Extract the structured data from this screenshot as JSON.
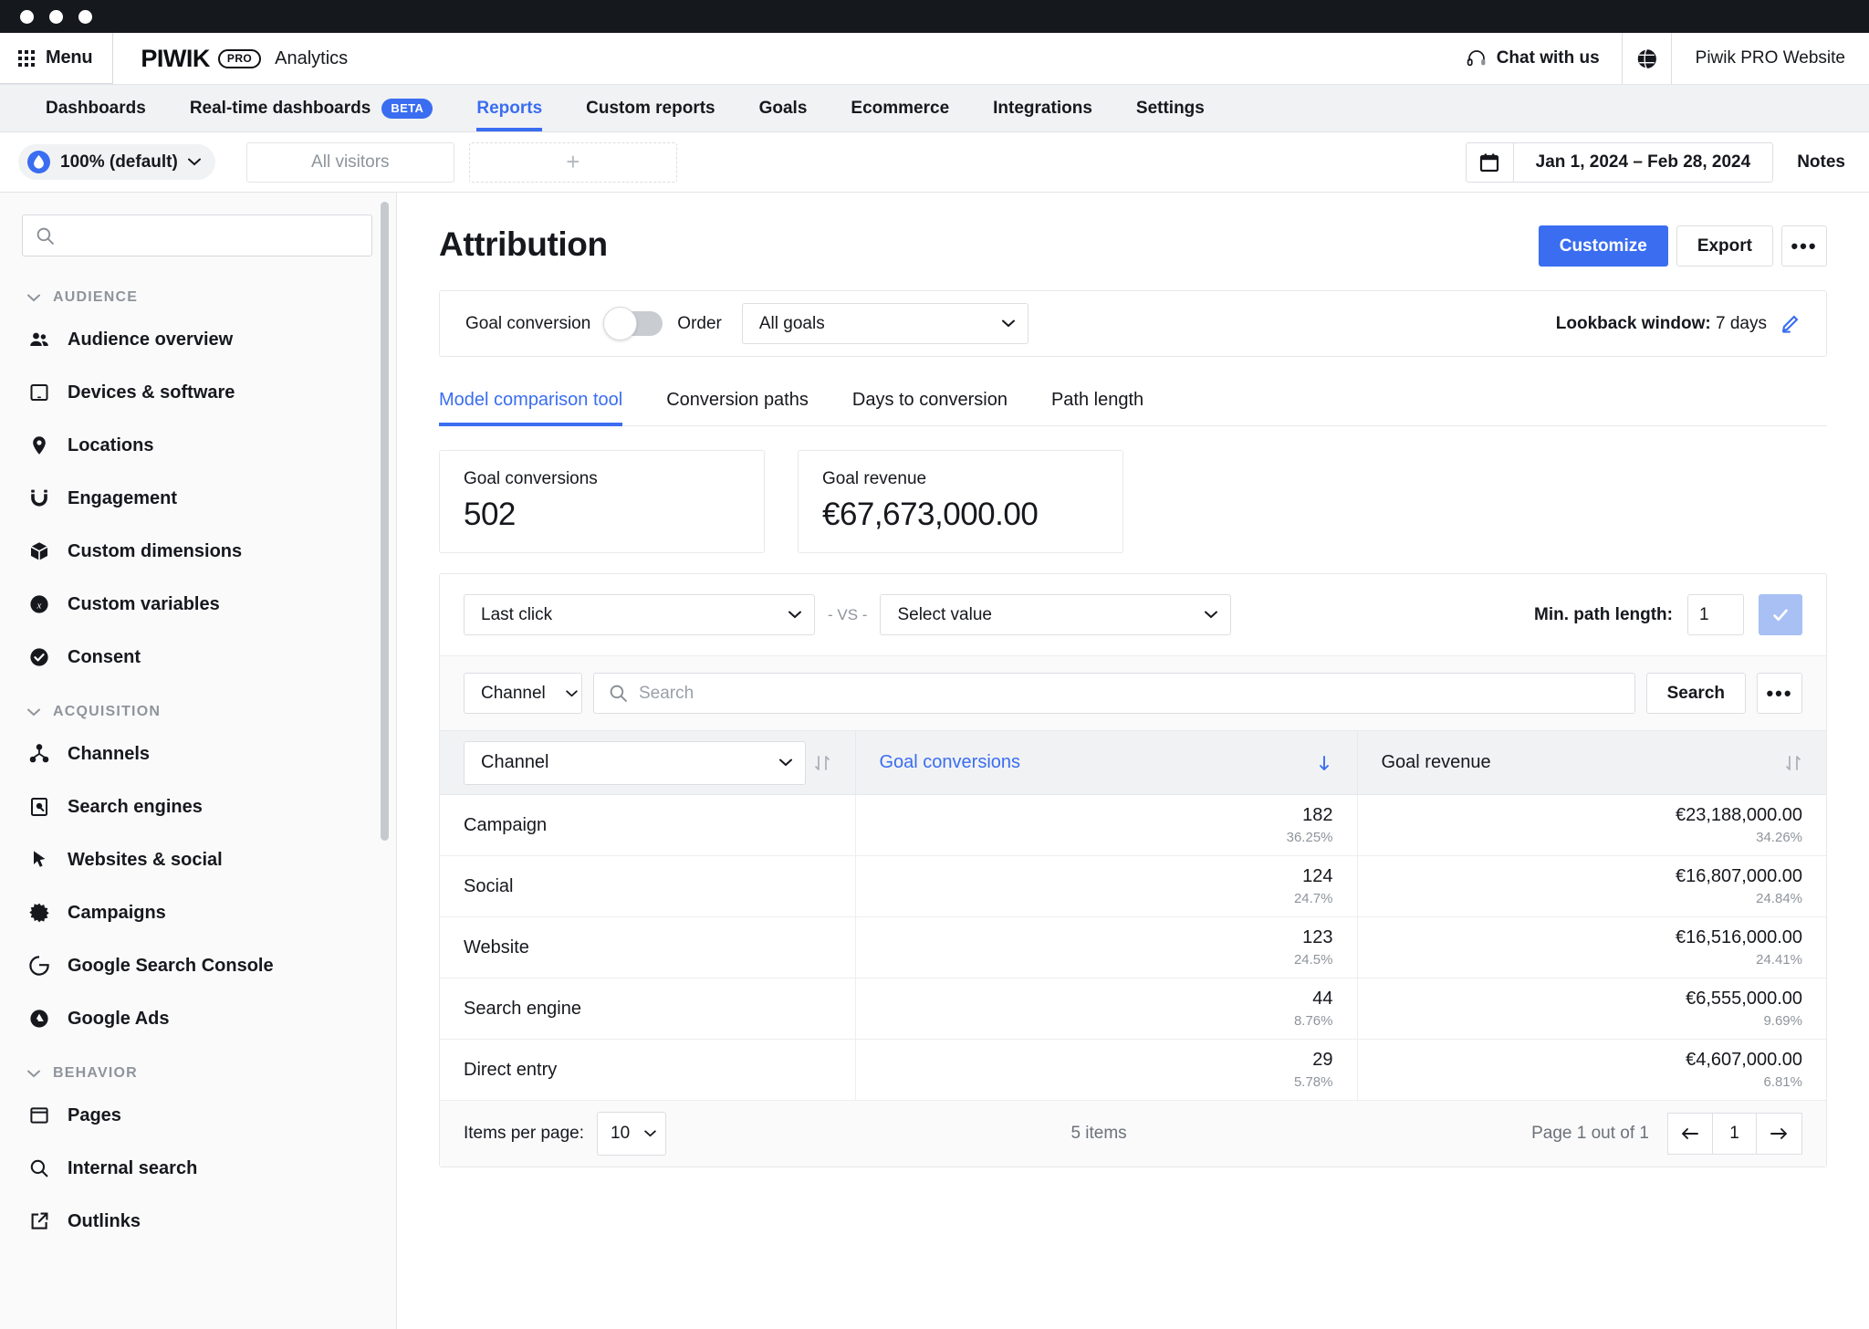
{
  "window": {
    "dots": 3
  },
  "appbar": {
    "menu_label": "Menu",
    "brand_piwik": "PIWIK",
    "brand_pro": "PRO",
    "brand_product": "Analytics",
    "chat_label": "Chat with us",
    "site_name": "Piwik PRO Website"
  },
  "nav": {
    "items": [
      {
        "label": "Dashboards",
        "active": false,
        "badge": ""
      },
      {
        "label": "Real-time dashboards",
        "active": false,
        "badge": "BETA"
      },
      {
        "label": "Reports",
        "active": true,
        "badge": ""
      },
      {
        "label": "Custom reports",
        "active": false,
        "badge": ""
      },
      {
        "label": "Goals",
        "active": false,
        "badge": ""
      },
      {
        "label": "Ecommerce",
        "active": false,
        "badge": ""
      },
      {
        "label": "Integrations",
        "active": false,
        "badge": ""
      },
      {
        "label": "Settings",
        "active": false,
        "badge": ""
      }
    ]
  },
  "subbar": {
    "sampling_label": "100% (default)",
    "segment_label": "All visitors",
    "segment_add_label": "+",
    "date_range": "Jan 1, 2024 – Feb 28, 2024",
    "notes_label": "Notes"
  },
  "sidebar": {
    "search_placeholder": "",
    "search_value": "",
    "sections": [
      {
        "title": "AUDIENCE",
        "items": [
          {
            "label": "Audience overview",
            "icon": "people-icon"
          },
          {
            "label": "Devices & software",
            "icon": "tablet-icon"
          },
          {
            "label": "Locations",
            "icon": "map-pin-icon"
          },
          {
            "label": "Engagement",
            "icon": "magnet-icon"
          },
          {
            "label": "Custom dimensions",
            "icon": "cube-icon"
          },
          {
            "label": "Custom variables",
            "icon": "variable-icon"
          },
          {
            "label": "Consent",
            "icon": "check-circle-icon"
          }
        ]
      },
      {
        "title": "ACQUISITION",
        "items": [
          {
            "label": "Channels",
            "icon": "share-nodes-icon"
          },
          {
            "label": "Search engines",
            "icon": "search-page-icon"
          },
          {
            "label": "Websites & social",
            "icon": "cursor-icon"
          },
          {
            "label": "Campaigns",
            "icon": "burst-icon"
          },
          {
            "label": "Google Search Console",
            "icon": "google-g-icon"
          },
          {
            "label": "Google Ads",
            "icon": "google-ads-icon"
          }
        ]
      },
      {
        "title": "BEHAVIOR",
        "items": [
          {
            "label": "Pages",
            "icon": "window-icon"
          },
          {
            "label": "Internal search",
            "icon": "search-icon"
          },
          {
            "label": "Outlinks",
            "icon": "external-link-icon"
          }
        ]
      }
    ]
  },
  "main": {
    "title": "Attribution",
    "customize_label": "Customize",
    "export_label": "Export",
    "more_label": "•••",
    "settings": {
      "goal_conversion_label": "Goal conversion",
      "toggle_state": "off",
      "order_label": "Order",
      "goals_select_value": "All goals",
      "lookback_label": "Lookback window:",
      "lookback_value": "7 days"
    },
    "tabs": [
      {
        "label": "Model comparison tool",
        "active": true
      },
      {
        "label": "Conversion paths",
        "active": false
      },
      {
        "label": "Days to conversion",
        "active": false
      },
      {
        "label": "Path length",
        "active": false
      }
    ],
    "kpis": [
      {
        "label": "Goal conversions",
        "value": "502"
      },
      {
        "label": "Goal revenue",
        "value": "€67,673,000.00"
      }
    ],
    "models": {
      "model_a": "Last click",
      "vs_label": "- VS -",
      "model_b": "Select value",
      "min_path_label": "Min. path length:",
      "min_path_value": "1",
      "confirm_icon": "check-icon"
    },
    "search_row": {
      "dimension_select": "Channel",
      "search_placeholder": "Search",
      "search_value": "",
      "search_button": "Search",
      "more_label": "•••"
    },
    "table": {
      "columns": [
        {
          "label": "Channel",
          "type": "select",
          "sort": "unsorted",
          "align": "left"
        },
        {
          "label": "Goal conversions",
          "type": "metric",
          "sort": "desc",
          "align": "left",
          "highlight": true
        },
        {
          "label": "Goal revenue",
          "type": "metric",
          "sort": "unsorted",
          "align": "left",
          "highlight": false
        }
      ],
      "rows": [
        {
          "channel": "Campaign",
          "conversions": "182",
          "conversions_pct": "36.25%",
          "revenue": "€23,188,000.00",
          "revenue_pct": "34.26%"
        },
        {
          "channel": "Social",
          "conversions": "124",
          "conversions_pct": "24.7%",
          "revenue": "€16,807,000.00",
          "revenue_pct": "24.84%"
        },
        {
          "channel": "Website",
          "conversions": "123",
          "conversions_pct": "24.5%",
          "revenue": "€16,516,000.00",
          "revenue_pct": "24.41%"
        },
        {
          "channel": "Search engine",
          "conversions": "44",
          "conversions_pct": "8.76%",
          "revenue": "€6,555,000.00",
          "revenue_pct": "9.69%"
        },
        {
          "channel": "Direct entry",
          "conversions": "29",
          "conversions_pct": "5.78%",
          "revenue": "€4,607,000.00",
          "revenue_pct": "6.81%"
        }
      ],
      "footer": {
        "items_per_page_label": "Items per page:",
        "items_per_page_value": "10",
        "items_count": "5 items",
        "page_text": "Page 1 out of 1",
        "page_number": "1"
      }
    }
  },
  "colors": {
    "accent": "#3a6df0",
    "accent_muted": "#a8c0f4",
    "text": "#16181d",
    "muted": "#8f949b",
    "panel_bg": "#fafafb",
    "border": "#e6e8eb",
    "chrome": "#15181c"
  },
  "chart_data": {
    "type": "table",
    "title": "Attribution — Model comparison tool (Last click)",
    "categories": [
      "Campaign",
      "Social",
      "Website",
      "Search engine",
      "Direct entry"
    ],
    "series": [
      {
        "name": "Goal conversions",
        "values": [
          182,
          124,
          123,
          44,
          29
        ]
      },
      {
        "name": "Goal conversions %",
        "values": [
          36.25,
          24.7,
          24.5,
          8.76,
          5.78
        ]
      },
      {
        "name": "Goal revenue (EUR)",
        "values": [
          23188000.0,
          16807000.0,
          16516000.0,
          6555000.0,
          4607000.0
        ]
      },
      {
        "name": "Goal revenue %",
        "values": [
          34.26,
          24.84,
          24.41,
          9.69,
          6.81
        ]
      }
    ],
    "totals": {
      "goal_conversions": 502,
      "goal_revenue": "€67,673,000.00"
    },
    "xlabel": "Channel",
    "ylabel": "",
    "legend": "none",
    "grid": false
  }
}
